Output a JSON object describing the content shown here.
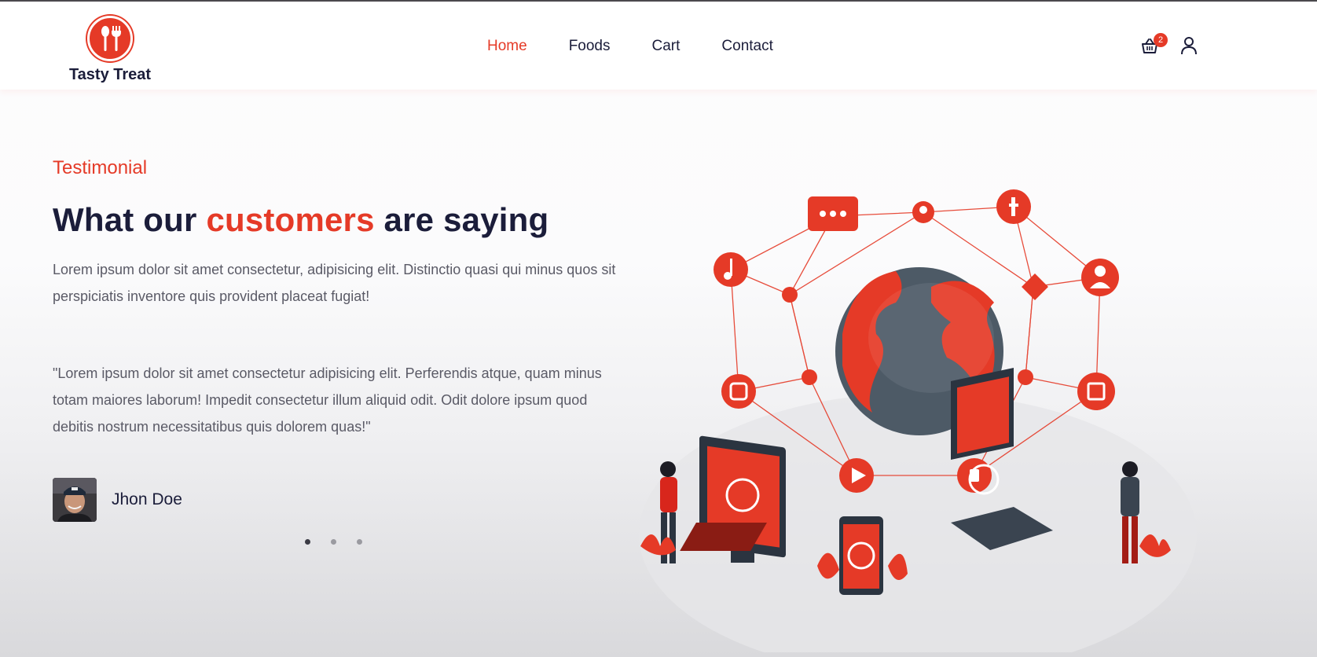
{
  "brand": {
    "name": "Tasty Treat",
    "logo_icon": "utensils-icon",
    "color": "#e53a27"
  },
  "nav": {
    "items": [
      {
        "label": "Home",
        "active": true
      },
      {
        "label": "Foods",
        "active": false
      },
      {
        "label": "Cart",
        "active": false
      },
      {
        "label": "Contact",
        "active": false
      }
    ]
  },
  "header_actions": {
    "cart_icon": "basket-icon",
    "cart_count": "2",
    "user_icon": "user-icon"
  },
  "testimonial": {
    "eyebrow": "Testimonial",
    "headline_part1": "What our ",
    "headline_accent": "customers",
    "headline_part2": " are saying",
    "intro": "Lorem ipsum dolor sit amet consectetur, adipisicing elit. Distinctio quasi qui minus quos sit perspiciatis inventore quis provident placeat fugiat!",
    "quote": "\"Lorem ipsum dolor sit amet consectetur adipisicing elit. Perferendis atque, quam minus totam maiores laborum! Impedit consectetur illum aliquid odit. Odit dolore ipsum quod debitis nostrum necessitatibus quis dolorem quas!\"",
    "author": "Jhon Doe",
    "slides": 3,
    "active_slide": 0
  },
  "colors": {
    "accent": "#e53a27",
    "heading": "#1b1d3a",
    "body": "#5a5a66"
  }
}
